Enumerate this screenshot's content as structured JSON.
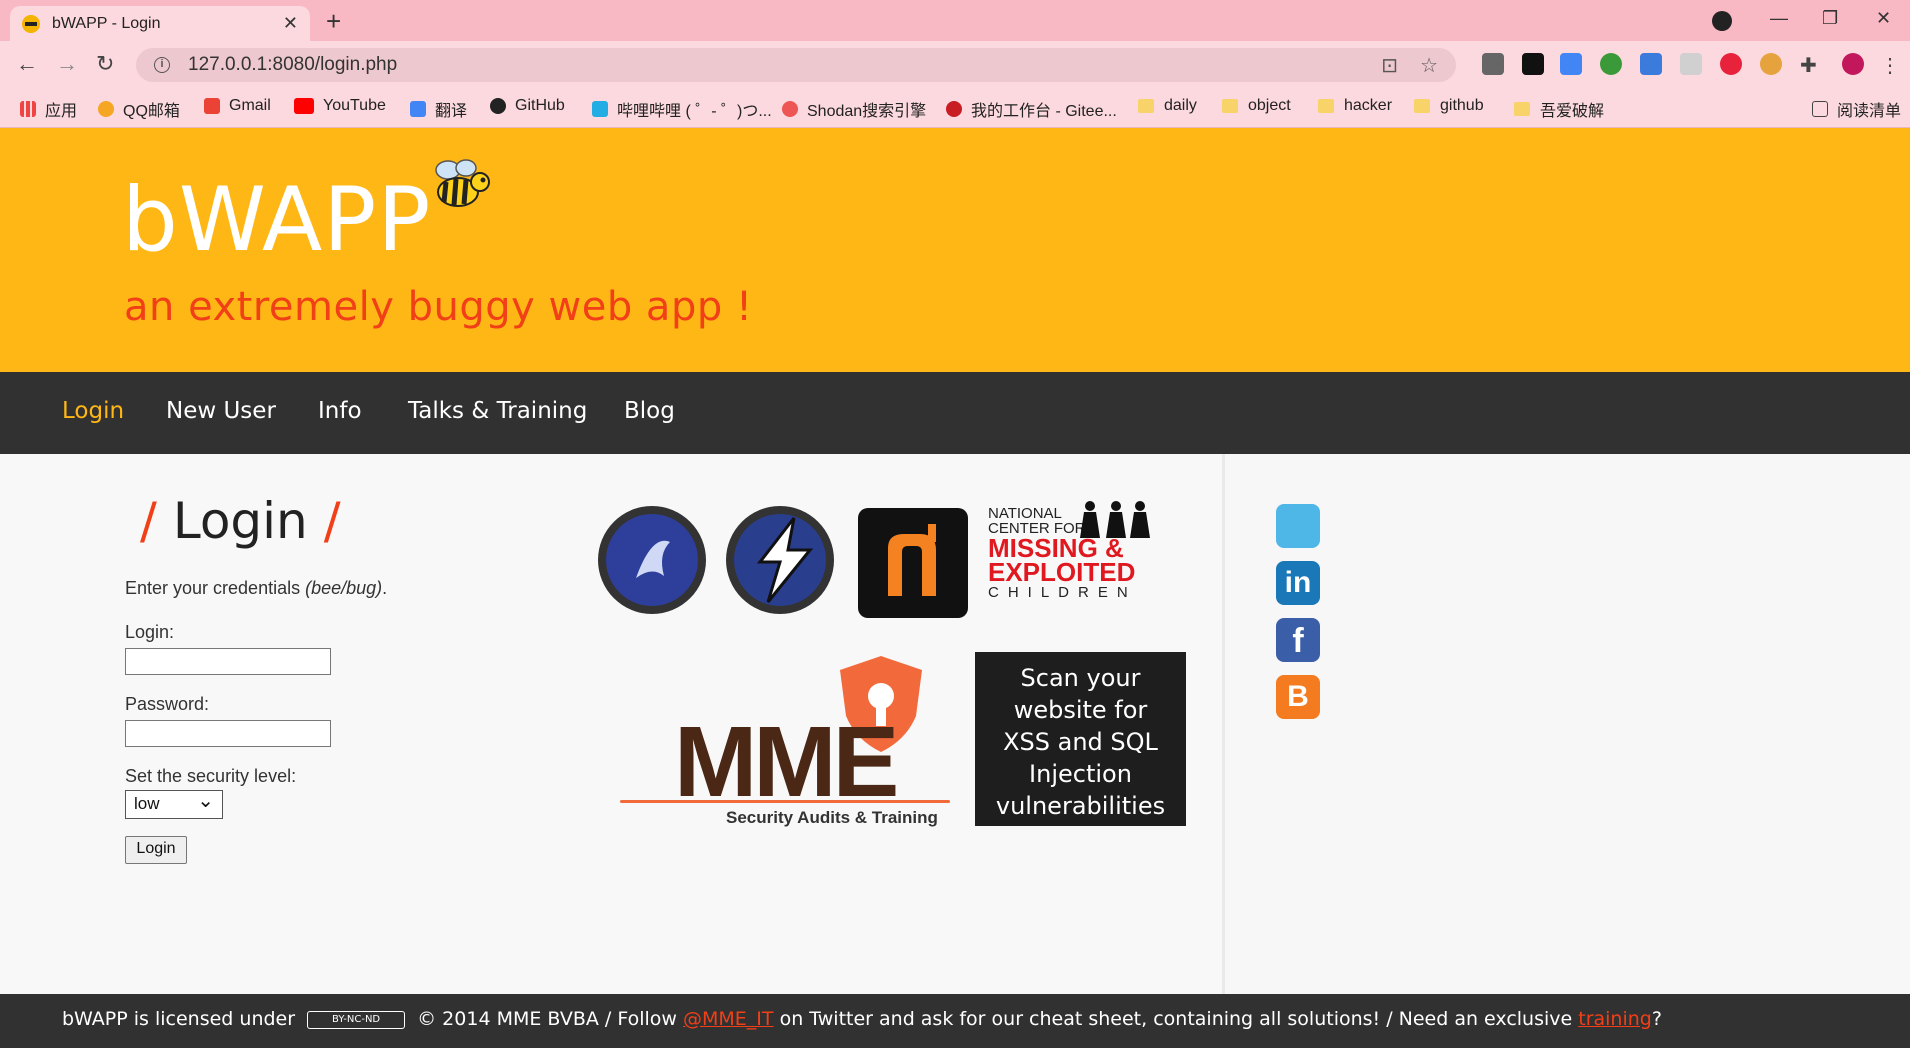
{
  "browser": {
    "tab_title": "bWAPP - Login",
    "url": "127.0.0.1:8080/login.php",
    "bookmarks": [
      {
        "label": "应用"
      },
      {
        "label": "QQ邮箱"
      },
      {
        "label": "Gmail"
      },
      {
        "label": "YouTube"
      },
      {
        "label": "翻译"
      },
      {
        "label": "GitHub"
      },
      {
        "label": "哔哩哔哩 ( ゜- ゜)つ..."
      },
      {
        "label": "Shodan搜索引擎"
      },
      {
        "label": "我的工作台 - Gitee..."
      },
      {
        "label": "daily"
      },
      {
        "label": "object"
      },
      {
        "label": "hacker"
      },
      {
        "label": "github"
      },
      {
        "label": "吾爱破解"
      }
    ],
    "reading_list": "阅读清单"
  },
  "header": {
    "logo": "bWAPP",
    "tagline": "an extremely buggy web app !"
  },
  "menu": [
    {
      "label": "Login",
      "active": true
    },
    {
      "label": "New User"
    },
    {
      "label": "Info"
    },
    {
      "label": "Talks & Training"
    },
    {
      "label": "Blog"
    }
  ],
  "login": {
    "title": "Login",
    "intro": "Enter your credentials",
    "intro_hint": "(bee/bug)",
    "intro_end": ".",
    "login_label": "Login:",
    "password_label": "Password:",
    "security_label": "Set the security level:",
    "security_value": "low",
    "submit": "Login"
  },
  "sponsors": {
    "ncmec_line1": "NATIONAL",
    "ncmec_line2": "CENTER FOR",
    "ncmec_line3": "MISSING &",
    "ncmec_line4": "EXPLOITED",
    "ncmec_line5": "CHILDREN",
    "mme_text": "MME",
    "mme_sub": "Security Audits & Training",
    "scan_text": "Scan your website for XSS and SQL Injection vulnerabilities"
  },
  "footer": {
    "part1": "bWAPP is licensed under",
    "cc": "BY-NC-ND",
    "part2": "© 2014 MME BVBA / Follow",
    "twitter": "@MME_IT",
    "part3": "on Twitter and ask for our cheat sheet, containing all solutions! / Need an exclusive",
    "training": "training",
    "part4": "?"
  },
  "colors": {
    "header_bg": "#ffb716",
    "accent": "#f13f17",
    "menu_bg": "#313131"
  }
}
